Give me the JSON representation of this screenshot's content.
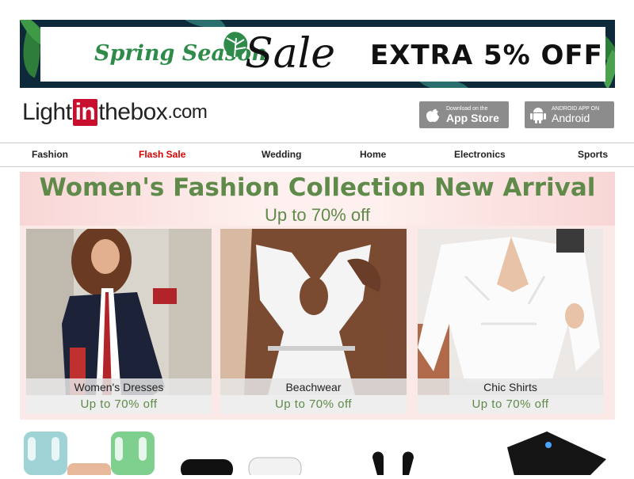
{
  "banner": {
    "spring_text": "Spring Season",
    "sale_text": "Sale",
    "offer_text": "EXTRA 5% OFF"
  },
  "logo": {
    "light": "Light",
    "in": "in",
    "thebox": "thebox",
    "com": ".com"
  },
  "app_buttons": {
    "ios": {
      "small": "Download on the",
      "large": "App Store",
      "icon": "apple-icon"
    },
    "android": {
      "small": "ANDROID APP ON",
      "large": "Android",
      "icon": "android-icon"
    }
  },
  "nav": {
    "items": [
      "Fashion",
      "Flash Sale",
      "Wedding",
      "Home",
      "Electronics",
      "Sports"
    ]
  },
  "promo": {
    "title": "Women's Fashion Collection New Arrival",
    "subtitle": "Up to 70% off",
    "cards": [
      {
        "label": "Women's Dresses",
        "offer": "Up to 70% off"
      },
      {
        "label": "Beachwear",
        "offer": "Up to 70% off"
      },
      {
        "label": "Chic Shirts",
        "offer": "Up to 70% off"
      }
    ]
  },
  "colors": {
    "accent_green": "#5f8a4a",
    "flash_red": "#d40000",
    "logo_red": "#c8102e"
  }
}
